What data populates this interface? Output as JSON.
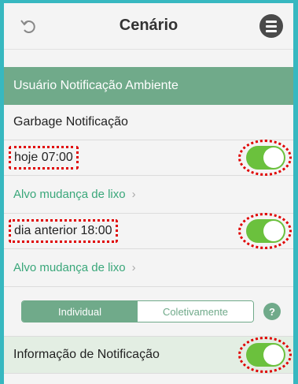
{
  "header": {
    "title": "Cenário"
  },
  "section": {
    "title": "Usuário Notificação Ambiente"
  },
  "garbage": {
    "label": "Garbage Notificação",
    "entries": [
      {
        "time": "hoje 07:00",
        "link": "Alvo mudança de lixo",
        "enabled": true
      },
      {
        "time": "dia anterior 18:00",
        "link": "Alvo mudança de lixo",
        "enabled": true
      }
    ],
    "chevron": "›"
  },
  "mode": {
    "options": [
      "Individual",
      "Coletivamente"
    ],
    "selected": "Individual",
    "help": "?"
  },
  "info": {
    "label": "Informação de Notificação",
    "enabled": true
  },
  "colors": {
    "accent": "#70aa8a",
    "toggle_on": "#6bc13d",
    "highlight": "#e00000",
    "link": "#3aa77a"
  }
}
